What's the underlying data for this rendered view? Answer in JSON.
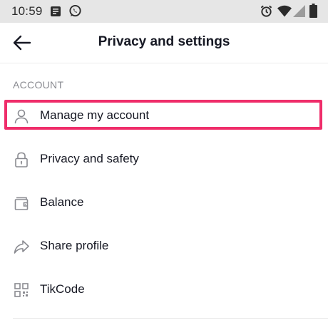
{
  "status_bar": {
    "time": "10:59",
    "left_icons": [
      "news-icon",
      "whatsapp-icon"
    ],
    "right_icons": [
      "alarm-icon",
      "wifi-icon",
      "signal-icon",
      "battery-icon"
    ]
  },
  "header": {
    "title": "Privacy and settings",
    "back_icon": "arrow-left-icon"
  },
  "section": {
    "label": "ACCOUNT"
  },
  "menu": {
    "items": [
      {
        "label": "Manage my account",
        "icon": "person-icon",
        "highlighted": true
      },
      {
        "label": "Privacy and safety",
        "icon": "lock-icon"
      },
      {
        "label": "Balance",
        "icon": "wallet-icon"
      },
      {
        "label": "Share profile",
        "icon": "share-icon"
      },
      {
        "label": "TikCode",
        "icon": "qr-code-icon"
      }
    ]
  },
  "colors": {
    "highlight": "#ef2d6a",
    "status_bar_bg": "#e6e6e6",
    "text_primary": "#161823",
    "text_secondary": "#8a8b91",
    "icon_gray": "#8a8b91"
  }
}
